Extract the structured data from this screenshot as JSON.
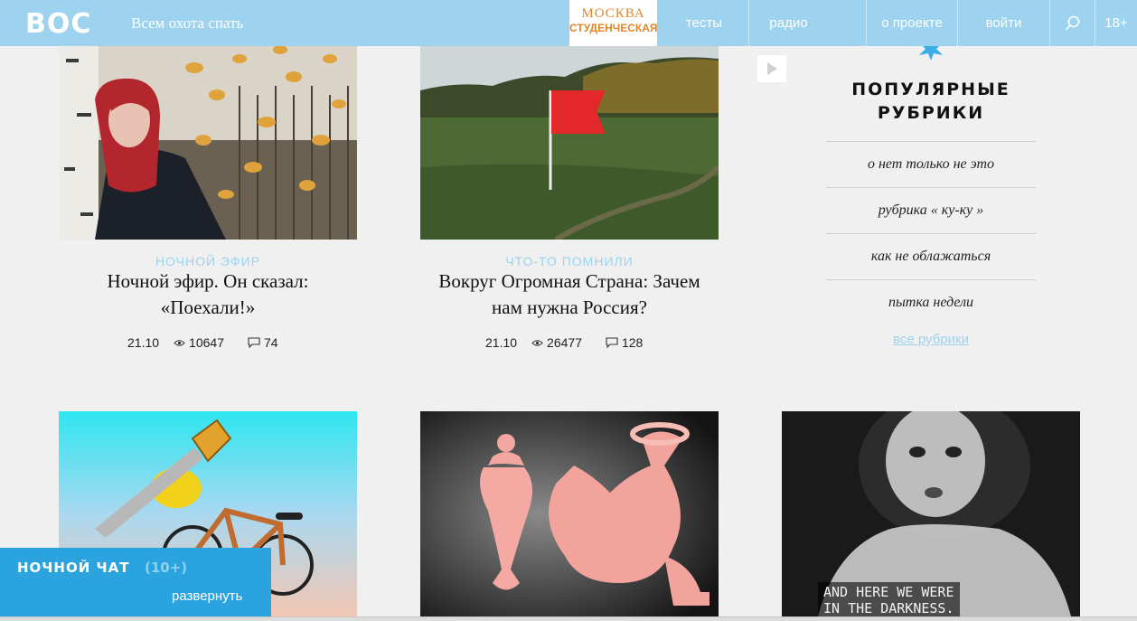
{
  "header": {
    "logo": "ВОС",
    "tagline": "Всем охота спать",
    "radio_logo_line1": "МОСКВА",
    "radio_logo_line2": "СТУДЕНЧЕСКАЯ",
    "nav": {
      "tests": "тесты",
      "radio": "радио",
      "about": "о проекте",
      "login": "войти",
      "age": "18+"
    }
  },
  "articles": [
    {
      "rubric": "НОЧНОЙ ЭФИР",
      "title_line1": "Ночной эфир. Он сказал:",
      "title_line2": "«Поехали!»",
      "date": "21.10",
      "views": "10647",
      "comments": "74"
    },
    {
      "rubric": "ЧТО-ТО ПОМНИЛИ",
      "title_line1": "Вокруг Огромная Страна: Зачем",
      "title_line2": "нам нужна Россия?",
      "date": "21.10",
      "views": "26477",
      "comments": "128"
    }
  ],
  "sidebar": {
    "title_line1": "ПОПУЛЯРНЫЕ",
    "title_line2": "РУБРИКИ",
    "rubrics": [
      "о нет только не это",
      "рубрика « ку-ку »",
      "как не облажаться",
      "пытка недели"
    ],
    "all_link": "все рубрики"
  },
  "chat": {
    "title": "НОЧНОЙ ЧАТ",
    "count": "(10+)",
    "expand": "развернуть"
  },
  "image_caption": {
    "line1": "AND HERE WE WERE",
    "line2": "IN THE DARKNESS."
  },
  "colors": {
    "header_bg": "#9dd3ee",
    "accent_blue": "#2aa3df",
    "radio_orange": "#e2862a"
  }
}
